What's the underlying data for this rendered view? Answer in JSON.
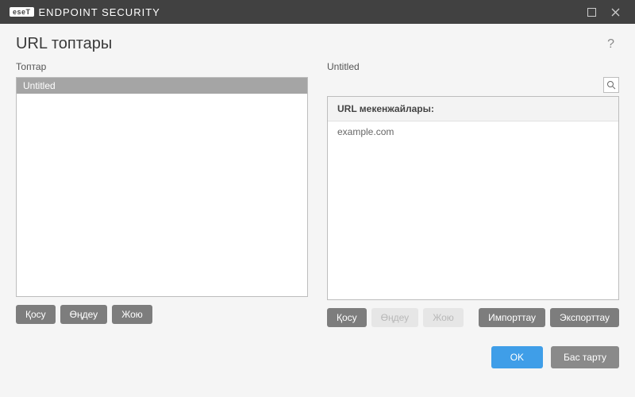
{
  "titlebar": {
    "brand_badge": "eseT",
    "brand_text_light": "ENDPOINT",
    "brand_text_bold": "SECURITY"
  },
  "header": {
    "title": "URL топтары"
  },
  "left": {
    "label": "Топтар",
    "items": [
      {
        "name": "Untitled",
        "selected": true
      }
    ],
    "buttons": {
      "add": "Қосу",
      "edit": "Өңдеу",
      "delete": "Жою"
    }
  },
  "right": {
    "label": "Untitled",
    "panel_header": "URL мекенжайлары:",
    "urls": [
      "example.com"
    ],
    "buttons": {
      "add": "Қосу",
      "edit": "Өңдеу",
      "edit_disabled": true,
      "delete": "Жою",
      "delete_disabled": true,
      "import": "Импорттау",
      "export": "Экспорттау"
    }
  },
  "footer": {
    "ok": "OK",
    "cancel": "Бас тарту"
  }
}
